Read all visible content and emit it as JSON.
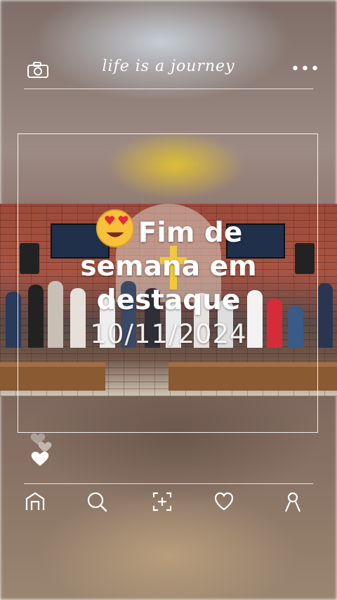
{
  "header": {
    "brand_text": "life is a journey",
    "camera_icon": "camera-icon",
    "more_icon": "more-dots-icon",
    "more_glyph": "•••"
  },
  "post": {
    "title_emoji": "heart-eyes-emoji-icon",
    "title_line1": "Fim de",
    "title_line2": "semana em",
    "title_line3": "destaque",
    "date": "10/11/2024"
  },
  "reactions": {
    "icon": "hearts-icon"
  },
  "bottom_nav": {
    "items": [
      {
        "icon": "home-icon"
      },
      {
        "icon": "search-icon"
      },
      {
        "icon": "add-icon"
      },
      {
        "icon": "heart-icon"
      },
      {
        "icon": "profile-icon"
      }
    ]
  },
  "colors": {
    "foreground": "#ffffff",
    "cross": "#f1c93a",
    "brick": "#a85443"
  }
}
